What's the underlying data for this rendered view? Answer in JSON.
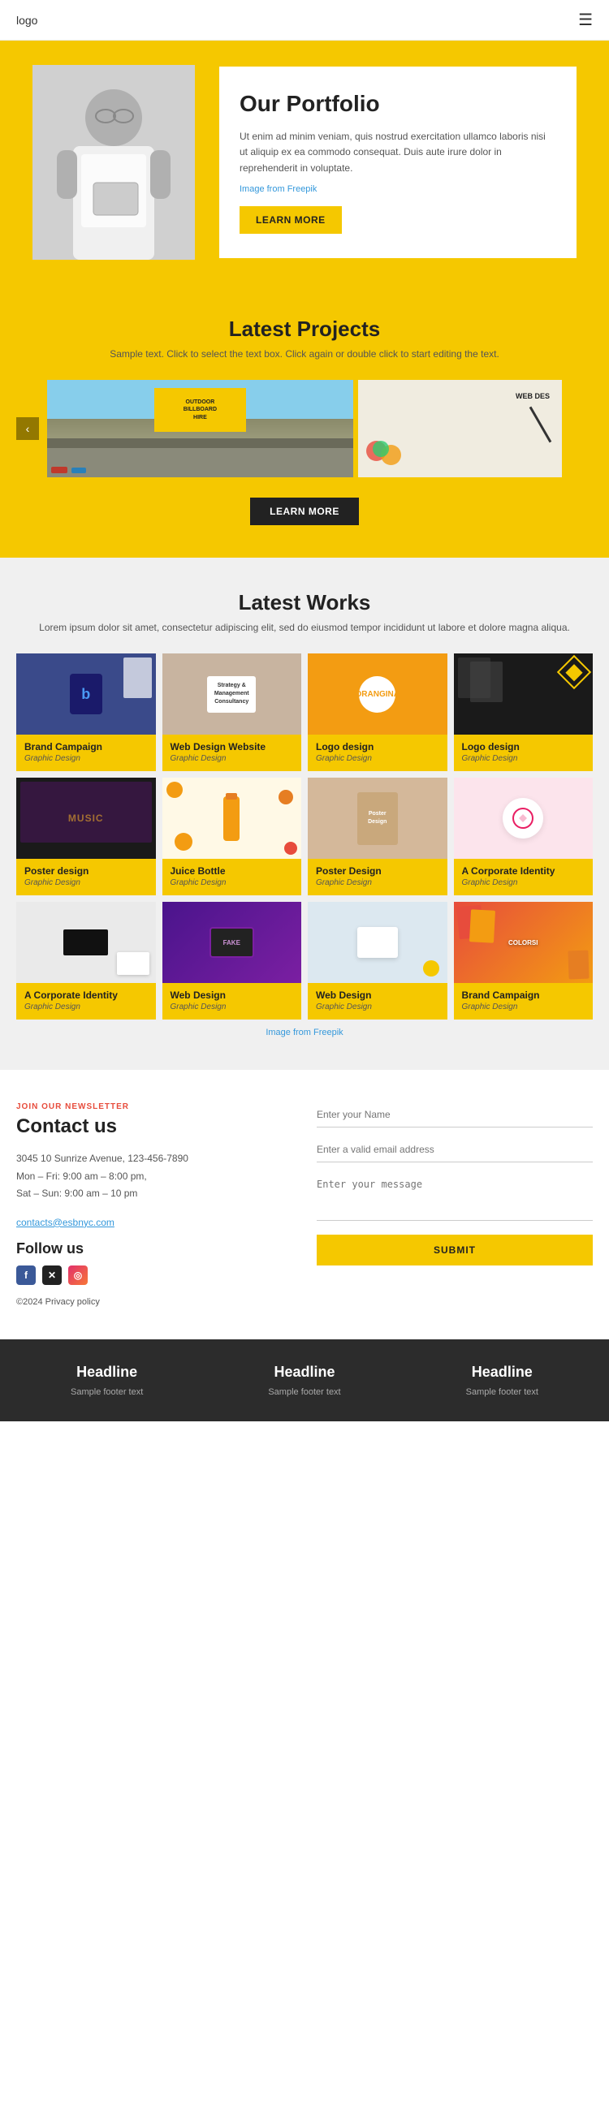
{
  "header": {
    "logo": "logo",
    "menu_icon": "☰"
  },
  "hero": {
    "title": "Our Portfolio",
    "description": "Ut enim ad minim veniam, quis nostrud exercitation ullamco laboris nisi ut aliquip ex ea commodo consequat. Duis aute irure dolor in reprehenderit in voluptate.",
    "image_credit_prefix": "Image from ",
    "image_credit_source": "Freepik",
    "button_label": "LEARN MORE"
  },
  "latest_projects": {
    "title": "Latest Projects",
    "subtitle": "Sample text. Click to select the text box. Click again or double click to start editing the text.",
    "button_label": "LEARN MORE",
    "slider_left_arrow": "‹",
    "slider_right_arrow": "›",
    "images": [
      {
        "label": "OUTDOOR BILLBOARD HIRE",
        "bg": "billboard"
      },
      {
        "label": "WEB DES",
        "bg": "webdes"
      }
    ]
  },
  "latest_works": {
    "title": "Latest Works",
    "subtitle": "Lorem ipsum dolor sit amet, consectetur adipiscing elit, sed do eiusmod tempor incididunt ut labore et dolore magna aliqua.",
    "image_credit_prefix": "Image from ",
    "image_credit_source": "Freepik",
    "items": [
      {
        "title": "Brand Campaign",
        "category": "Graphic Design",
        "bg": "brand"
      },
      {
        "title": "Web Design Website",
        "category": "Graphic Design",
        "bg": "webdes2"
      },
      {
        "title": "Logo design",
        "category": "Graphic Design",
        "bg": "logo1"
      },
      {
        "title": "Logo design",
        "category": "Graphic Design",
        "bg": "logo2"
      },
      {
        "title": "Poster design",
        "category": "Graphic Design",
        "bg": "poster"
      },
      {
        "title": "Juice Bottle",
        "category": "Graphic Design",
        "bg": "juice"
      },
      {
        "title": "Poster Design",
        "category": "Graphic Design",
        "bg": "poster2"
      },
      {
        "title": "A Corporate Identity",
        "category": "Graphic Design",
        "bg": "corporate"
      },
      {
        "title": "A Corporate Identity",
        "category": "Graphic Design",
        "bg": "corporate2"
      },
      {
        "title": "Web Design",
        "category": "Graphic Design",
        "bg": "webdes3"
      },
      {
        "title": "Web Design",
        "category": "Graphic Design",
        "bg": "webdes4"
      },
      {
        "title": "Brand Campaign",
        "category": "Graphic Design",
        "bg": "brand2"
      }
    ]
  },
  "contact": {
    "newsletter_label": "JOIN OUR NEWSLETTER",
    "title": "Contact us",
    "address": "3045 10 Sunrize Avenue, 123-456-7890",
    "hours1": "Mon – Fri: 9:00 am – 8:00 pm,",
    "hours2": "Sat – Sun: 9:00 am – 10 pm",
    "email": "contacts@esbnyc.com",
    "follow_title": "Follow us",
    "copyright": "©2024 Privacy policy",
    "form": {
      "name_placeholder": "Enter your Name",
      "email_placeholder": "Enter a valid email address",
      "message_placeholder": "Enter your message",
      "submit_label": "SUBMIT"
    }
  },
  "footer": {
    "columns": [
      {
        "headline": "Headline",
        "text": "Sample footer text"
      },
      {
        "headline": "Headline",
        "text": "Sample footer text"
      },
      {
        "headline": "Headline",
        "text": "Sample footer text"
      }
    ]
  }
}
